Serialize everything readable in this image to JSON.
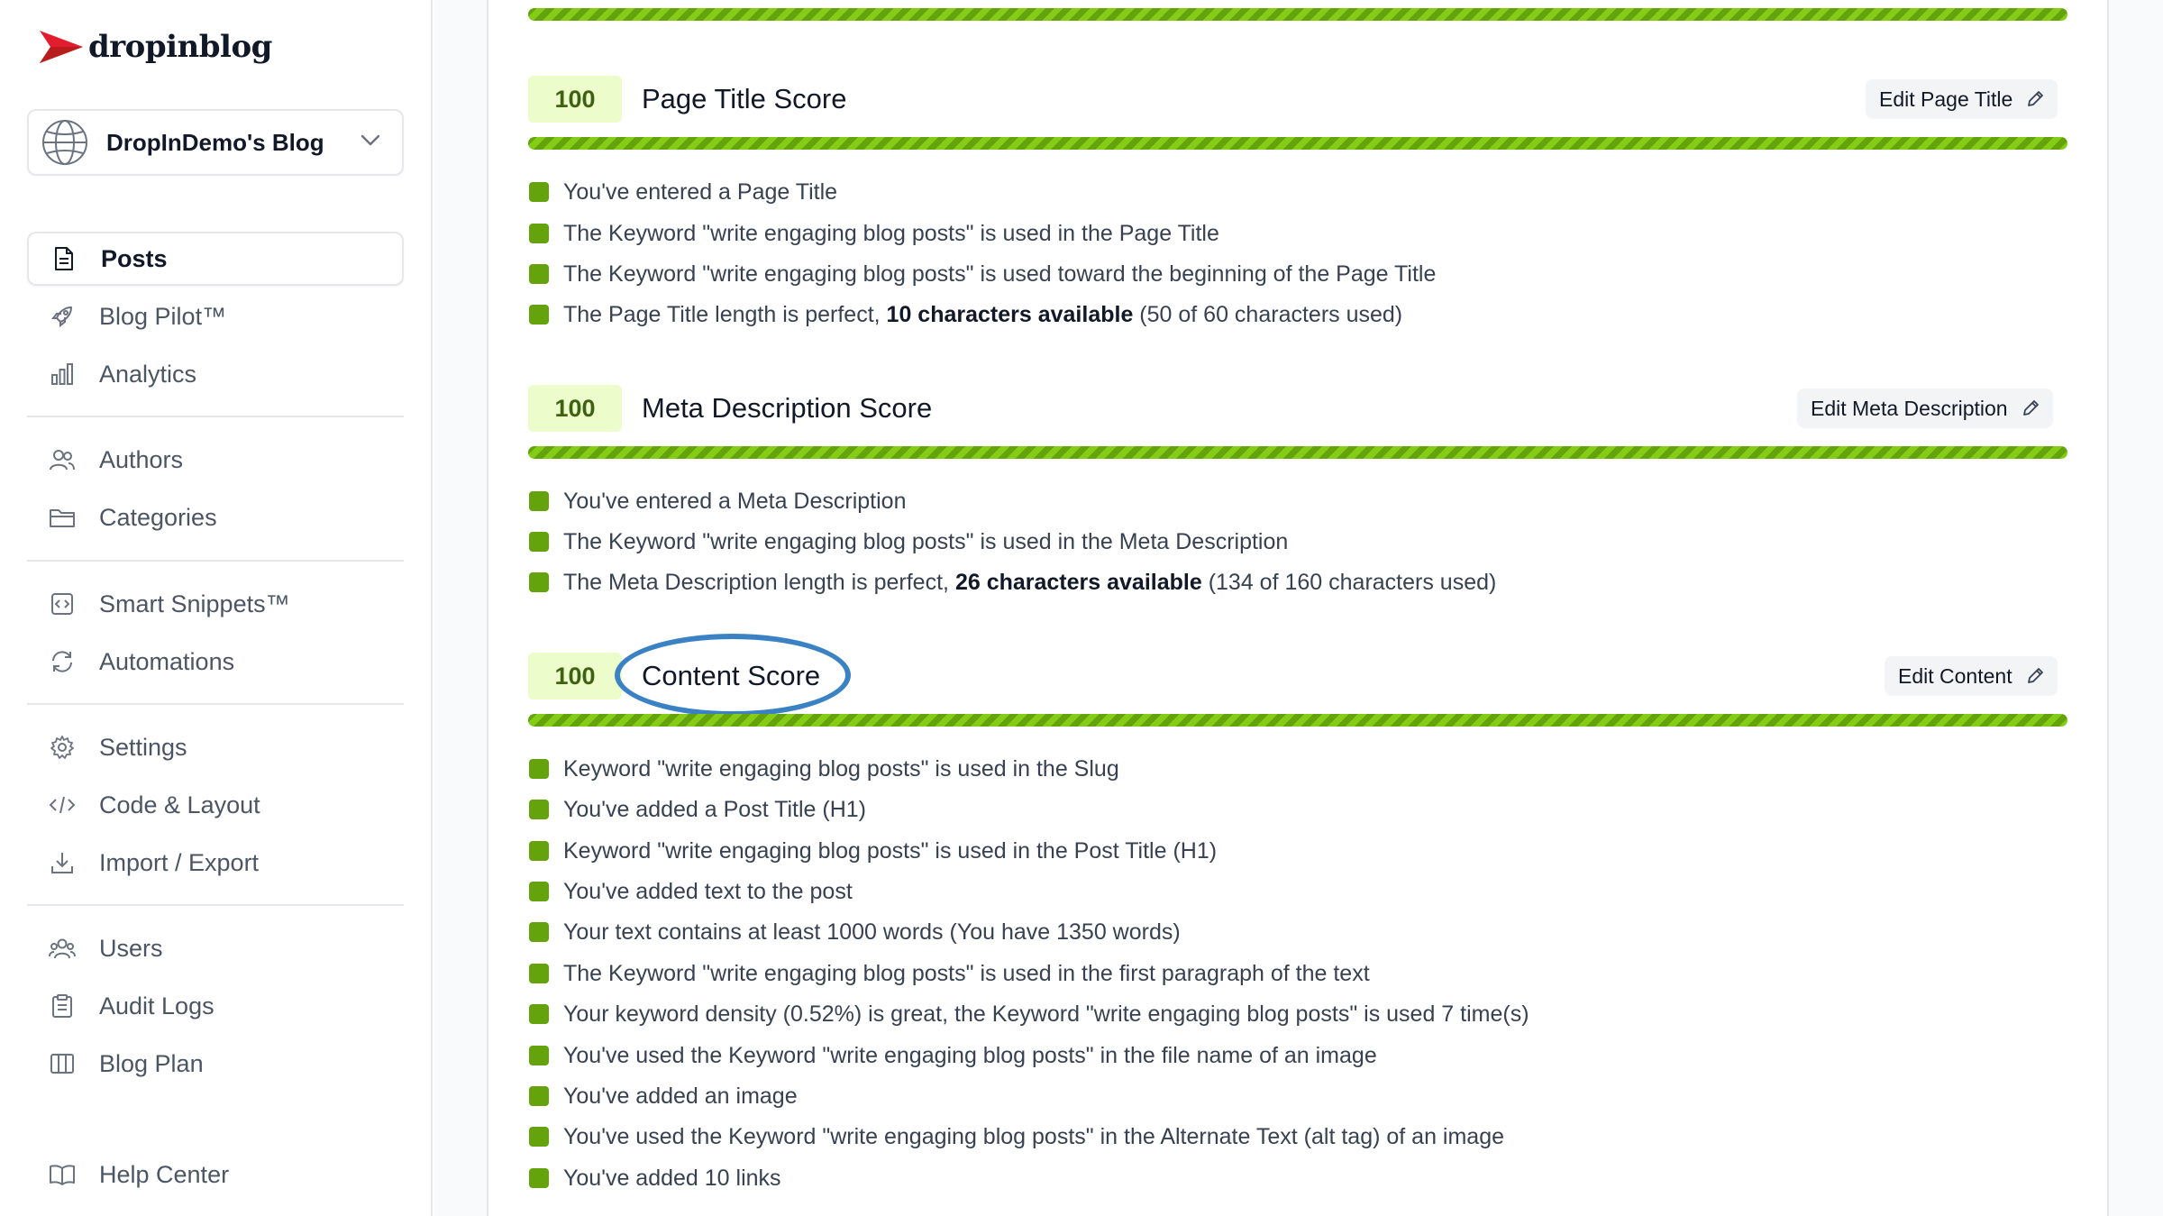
{
  "brand": {
    "name": "dropinblog",
    "accent": "#e11d2e"
  },
  "blog_selector": {
    "name": "DropInDemo's Blog",
    "icon": "globe-icon"
  },
  "nav": {
    "posts": "Posts",
    "blog_pilot": "Blog Pilot™",
    "analytics": "Analytics",
    "authors": "Authors",
    "categories": "Categories",
    "smart_snippets": "Smart Snippets™",
    "automations": "Automations",
    "settings": "Settings",
    "code_layout": "Code & Layout",
    "import_export": "Import / Export",
    "users": "Users",
    "audit_logs": "Audit Logs",
    "blog_plan": "Blog Plan",
    "help_center": "Help Center"
  },
  "sections": {
    "page_title": {
      "score": "100",
      "title": "Page Title Score",
      "edit_label": "Edit Page Title",
      "checks": [
        "You've entered a Page Title",
        "The Keyword \"write engaging blog posts\" is used in the Page Title",
        "The Keyword \"write engaging blog posts\" is used toward the beginning of the Page Title"
      ],
      "length_check": {
        "prefix": "The Page Title length is perfect, ",
        "bold": "10 characters available",
        "suffix": " (50 of 60 characters used)"
      }
    },
    "meta_description": {
      "score": "100",
      "title": "Meta Description Score",
      "edit_label": "Edit Meta Description",
      "checks": [
        "You've entered a Meta Description",
        "The Keyword \"write engaging blog posts\" is used in the Meta Description"
      ],
      "length_check": {
        "prefix": "The Meta Description length is perfect, ",
        "bold": "26 characters available",
        "suffix": " (134 of 160 characters used)"
      }
    },
    "content": {
      "score": "100",
      "title": "Content Score",
      "edit_label": "Edit Content",
      "checks": [
        "Keyword \"write engaging blog posts\" is used in the Slug",
        "You've added a Post Title (H1)",
        "Keyword \"write engaging blog posts\" is used in the Post Title (H1)",
        "You've added text to the post",
        "Your text contains at least 1000 words (You have 1350 words)",
        "The Keyword \"write engaging blog posts\" is used in the first paragraph of the text",
        "Your keyword density (0.52%) is great, the Keyword \"write engaging blog posts\" is used 7 time(s)",
        "You've used the Keyword \"write engaging blog posts\" in the file name of an image",
        "You've added an image",
        "You've used the Keyword \"write engaging blog posts\" in the Alternate Text (alt tag) of an image",
        "You've added 10 links"
      ]
    }
  },
  "colors": {
    "score_green": "#65a30d",
    "score_bg": "#ecfccb",
    "highlight_ring": "#3b82c4"
  }
}
